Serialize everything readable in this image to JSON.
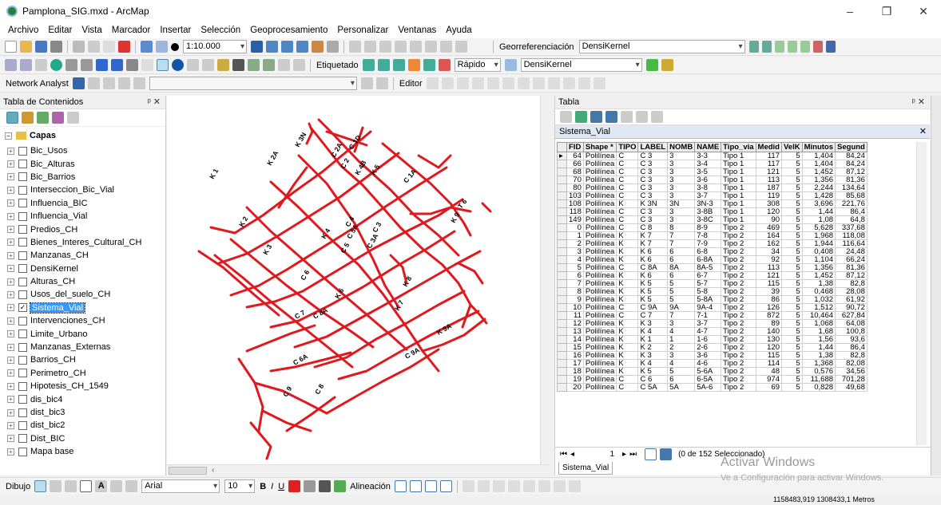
{
  "window": {
    "title": "Pamplona_SIG.mxd - ArcMap",
    "minimize": "–",
    "maximize": "❐",
    "close": "✕"
  },
  "menu": [
    "Archivo",
    "Editar",
    "Vista",
    "Marcador",
    "Insertar",
    "Selección",
    "Geoprocesamiento",
    "Personalizar",
    "Ventanas",
    "Ayuda"
  ],
  "toolbar1": {
    "scale": "1:10.000",
    "georef_label": "Georreferenciación",
    "georef_layer": "DensiKernel"
  },
  "toolbar2": {
    "labeling": "Etiquetado",
    "speed": "Rápido",
    "layer": "DensiKernel"
  },
  "toolbar3": {
    "network": "Network Analyst",
    "editor": "Editor"
  },
  "toc": {
    "title": "Tabla de Contenidos",
    "group": "Capas",
    "layers": [
      {
        "name": "Bic_Usos",
        "checked": false
      },
      {
        "name": "Bic_Alturas",
        "checked": false
      },
      {
        "name": "Bic_Barrios",
        "checked": false
      },
      {
        "name": "Interseccion_Bic_Vial",
        "checked": false
      },
      {
        "name": "Influencia_BIC",
        "checked": false
      },
      {
        "name": "Influencia_Vial",
        "checked": false
      },
      {
        "name": "Predios_CH",
        "checked": false
      },
      {
        "name": "Bienes_Interes_Cultural_CH",
        "checked": false
      },
      {
        "name": "Manzanas_CH",
        "checked": false
      },
      {
        "name": "DensiKernel",
        "checked": false
      },
      {
        "name": "Alturas_CH",
        "checked": false
      },
      {
        "name": "Usos_del_suelo_CH",
        "checked": false
      },
      {
        "name": "Sistema_Vial",
        "checked": true,
        "selected": true
      },
      {
        "name": "Intervenciones_CH",
        "checked": false
      },
      {
        "name": "Limite_Urbano",
        "checked": false
      },
      {
        "name": "Manzanas_Externas",
        "checked": false
      },
      {
        "name": "Barrios_CH",
        "checked": false
      },
      {
        "name": "Perimetro_CH",
        "checked": false
      },
      {
        "name": "Hipotesis_CH_1549",
        "checked": false
      },
      {
        "name": "dis_bic4",
        "checked": false
      },
      {
        "name": "dist_bic3",
        "checked": false
      },
      {
        "name": "dist_bic2",
        "checked": false
      },
      {
        "name": "Dist_BIC",
        "checked": false
      },
      {
        "name": "Mapa base",
        "checked": false
      }
    ]
  },
  "map": {
    "line_color": "#e0191f",
    "labels": [
      "C 1A",
      "C 1D",
      "C 2A",
      "C 2",
      "C 3",
      "C 4",
      "C 5",
      "C 6",
      "C 7",
      "C 8",
      "C 9",
      "C 3A",
      "C 5A",
      "C 6A",
      "C 8A",
      "C 9A",
      "K 1",
      "K 2",
      "K 2A",
      "K 3",
      "K 3N",
      "K 4",
      "K 4B",
      "K 5",
      "K 6",
      "K 7",
      "K 8",
      "K 9",
      "K 9A",
      "T 6"
    ]
  },
  "table": {
    "title": "Tabla",
    "tab_name": "Sistema_Vial",
    "columns": [
      "FID",
      "Shape *",
      "TIPO",
      "LABEL",
      "NOMB",
      "NAME",
      "Tipo_via",
      "Medid",
      "VelK",
      "Minutos",
      "Segund"
    ],
    "rows": [
      [
        "64",
        "Polilínea",
        "C",
        "C 3",
        "3",
        "3-3",
        "Tipo 1",
        "117",
        "5",
        "1,404",
        "84,24"
      ],
      [
        "66",
        "Polilínea",
        "C",
        "C 3",
        "3",
        "3-4",
        "Tipo 1",
        "117",
        "5",
        "1,404",
        "84,24"
      ],
      [
        "68",
        "Polilínea",
        "C",
        "C 3",
        "3",
        "3-5",
        "Tipo 1",
        "121",
        "5",
        "1,452",
        "87,12"
      ],
      [
        "70",
        "Polilínea",
        "C",
        "C 3",
        "3",
        "3-6",
        "Tipo 1",
        "113",
        "5",
        "1,356",
        "81,36"
      ],
      [
        "80",
        "Polilínea",
        "C",
        "C 3",
        "3",
        "3-8",
        "Tipo 1",
        "187",
        "5",
        "2,244",
        "134,64"
      ],
      [
        "103",
        "Polilínea",
        "C",
        "C 3",
        "3",
        "3-7",
        "Tipo 1",
        "119",
        "5",
        "1,428",
        "85,68"
      ],
      [
        "108",
        "Polilínea",
        "K",
        "K 3N",
        "3N",
        "3N-3",
        "Tipo 1",
        "308",
        "5",
        "3,696",
        "221,76"
      ],
      [
        "118",
        "Polilínea",
        "C",
        "C 3",
        "3",
        "3-8B",
        "Tipo 1",
        "120",
        "5",
        "1,44",
        "86,4"
      ],
      [
        "149",
        "Polilínea",
        "C",
        "C 3",
        "3",
        "3-8C",
        "Tipo 1",
        "90",
        "5",
        "1,08",
        "64,8"
      ],
      [
        "0",
        "Polilínea",
        "C",
        "C 8",
        "8",
        "8-9",
        "Tipo 2",
        "469",
        "5",
        "5,628",
        "337,68"
      ],
      [
        "1",
        "Polilínea",
        "K",
        "K 7",
        "7",
        "7-8",
        "Tipo 2",
        "164",
        "5",
        "1,968",
        "118,08"
      ],
      [
        "2",
        "Polilínea",
        "K",
        "K 7",
        "7",
        "7-9",
        "Tipo 2",
        "162",
        "5",
        "1,944",
        "116,64"
      ],
      [
        "3",
        "Polilínea",
        "K",
        "K 6",
        "6",
        "6-8",
        "Tipo 2",
        "34",
        "5",
        "0,408",
        "24,48"
      ],
      [
        "4",
        "Polilínea",
        "K",
        "K 6",
        "6",
        "6-8A",
        "Tipo 2",
        "92",
        "5",
        "1,104",
        "66,24"
      ],
      [
        "5",
        "Polilínea",
        "C",
        "C 8A",
        "8A",
        "8A-5",
        "Tipo 2",
        "113",
        "5",
        "1,356",
        "81,36"
      ],
      [
        "6",
        "Polilínea",
        "K",
        "K 6",
        "6",
        "6-7",
        "Tipo 2",
        "121",
        "5",
        "1,452",
        "87,12"
      ],
      [
        "7",
        "Polilínea",
        "K",
        "K 5",
        "5",
        "5-7",
        "Tipo 2",
        "115",
        "5",
        "1,38",
        "82,8"
      ],
      [
        "8",
        "Polilínea",
        "K",
        "K 5",
        "5",
        "5-8",
        "Tipo 2",
        "39",
        "5",
        "0,468",
        "28,08"
      ],
      [
        "9",
        "Polilínea",
        "K",
        "K 5",
        "5",
        "5-8A",
        "Tipo 2",
        "86",
        "5",
        "1,032",
        "61,92"
      ],
      [
        "10",
        "Polilínea",
        "C",
        "C 9A",
        "9A",
        "9A-4",
        "Tipo 2",
        "126",
        "5",
        "1,512",
        "90,72"
      ],
      [
        "11",
        "Polilínea",
        "C",
        "C 7",
        "7",
        "7-1",
        "Tipo 2",
        "872",
        "5",
        "10,464",
        "627,84"
      ],
      [
        "12",
        "Polilínea",
        "K",
        "K 3",
        "3",
        "3-7",
        "Tipo 2",
        "89",
        "5",
        "1,068",
        "64,08"
      ],
      [
        "13",
        "Polilínea",
        "K",
        "K 4",
        "4",
        "4-7",
        "Tipo 2",
        "140",
        "5",
        "1,68",
        "100,8"
      ],
      [
        "14",
        "Polilínea",
        "K",
        "K 1",
        "1",
        "1-6",
        "Tipo 2",
        "130",
        "5",
        "1,56",
        "93,6"
      ],
      [
        "15",
        "Polilínea",
        "K",
        "K 2",
        "2",
        "2-6",
        "Tipo 2",
        "120",
        "5",
        "1,44",
        "86,4"
      ],
      [
        "16",
        "Polilínea",
        "K",
        "K 3",
        "3",
        "3-6",
        "Tipo 2",
        "115",
        "5",
        "1,38",
        "82,8"
      ],
      [
        "17",
        "Polilínea",
        "K",
        "K 4",
        "4",
        "4-6",
        "Tipo 2",
        "114",
        "5",
        "1,368",
        "82,08"
      ],
      [
        "18",
        "Polilínea",
        "K",
        "K 5",
        "5",
        "5-6A",
        "Tipo 2",
        "48",
        "5",
        "0,576",
        "34,56"
      ],
      [
        "19",
        "Polilínea",
        "C",
        "C 6",
        "6",
        "6-5A",
        "Tipo 2",
        "974",
        "5",
        "11,688",
        "701,28"
      ],
      [
        "20",
        "Polilínea",
        "C",
        "C 5A",
        "5A",
        "5A-6",
        "Tipo 2",
        "69",
        "5",
        "0,828",
        "49,68"
      ]
    ],
    "record": "1",
    "selection": "(0 de 152 Seleccionado)"
  },
  "drawing": {
    "label": "Dibujo",
    "font": "Arial",
    "size": "10",
    "align": "Alineación"
  },
  "status": {
    "coords": "1158483,919  1308433,1 Metros"
  },
  "watermark": {
    "line1": "Activar Windows",
    "line2": "Ve a Configuración para activar Windows."
  }
}
